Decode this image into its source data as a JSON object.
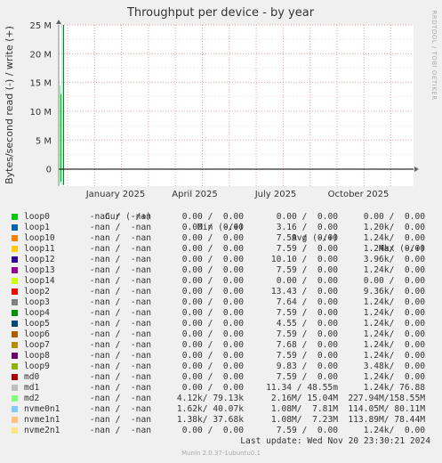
{
  "chart_data": {
    "type": "line",
    "title": "Throughput per device - by year",
    "ylabel": "Bytes/second read (-) / write (+)",
    "side_label": "RRDTOOL / TOBI OETIKER",
    "y_ticks": [
      "25 M",
      "20 M",
      "15 M",
      "10 M",
      "5 M",
      "0"
    ],
    "y_tick_values": [
      25000000,
      20000000,
      15000000,
      10000000,
      5000000,
      0
    ],
    "ylim": [
      -3000000,
      25000000
    ],
    "x_ticks": [
      "January 2025",
      "April 2025",
      "July 2025",
      "October 2025"
    ],
    "grid": true,
    "columns": [
      "Cur (-/+)",
      "Min (-/+)",
      "Avg (-/+)",
      "Max (-/+)"
    ],
    "series": [
      {
        "name": "loop0",
        "color": "#00cc00",
        "cur": "-nan /  -nan",
        "min": "0.00 /  0.00",
        "avg": "0.00 /  0.00",
        "max": "0.00 /  0.00"
      },
      {
        "name": "loop1",
        "color": "#0066b3",
        "cur": "-nan /  -nan",
        "min": "0.00 /  0.00",
        "avg": "3.16 /  0.00",
        "max": "1.20k/  0.00"
      },
      {
        "name": "loop10",
        "color": "#ff8000",
        "cur": "-nan /  -nan",
        "min": "0.00 /  0.00",
        "avg": "7.59 /  0.00",
        "max": "1.24k/  0.00"
      },
      {
        "name": "loop11",
        "color": "#ffcc00",
        "cur": "-nan /  -nan",
        "min": "0.00 /  0.00",
        "avg": "7.59 /  0.00",
        "max": "1.24k/  0.00"
      },
      {
        "name": "loop12",
        "color": "#330099",
        "cur": "-nan /  -nan",
        "min": "0.00 /  0.00",
        "avg": "10.10 /  0.00",
        "max": "3.96k/  0.00"
      },
      {
        "name": "loop13",
        "color": "#990099",
        "cur": "-nan /  -nan",
        "min": "0.00 /  0.00",
        "avg": "7.59 /  0.00",
        "max": "1.24k/  0.00"
      },
      {
        "name": "loop14",
        "color": "#ccff00",
        "cur": "-nan /  -nan",
        "min": "0.00 /  0.00",
        "avg": "0.00 /  0.00",
        "max": "0.00 /  0.00"
      },
      {
        "name": "loop2",
        "color": "#ff0000",
        "cur": "-nan /  -nan",
        "min": "0.00 /  0.00",
        "avg": "13.43 /  0.00",
        "max": "9.36k/  0.00"
      },
      {
        "name": "loop3",
        "color": "#808080",
        "cur": "-nan /  -nan",
        "min": "0.00 /  0.00",
        "avg": "7.64 /  0.00",
        "max": "1.24k/  0.00"
      },
      {
        "name": "loop4",
        "color": "#008f00",
        "cur": "-nan /  -nan",
        "min": "0.00 /  0.00",
        "avg": "7.59 /  0.00",
        "max": "1.24k/  0.00"
      },
      {
        "name": "loop5",
        "color": "#00487d",
        "cur": "-nan /  -nan",
        "min": "0.00 /  0.00",
        "avg": "4.55 /  0.00",
        "max": "1.24k/  0.00"
      },
      {
        "name": "loop6",
        "color": "#b35a00",
        "cur": "-nan /  -nan",
        "min": "0.00 /  0.00",
        "avg": "7.59 /  0.00",
        "max": "1.24k/  0.00"
      },
      {
        "name": "loop7",
        "color": "#b38f00",
        "cur": "-nan /  -nan",
        "min": "0.00 /  0.00",
        "avg": "7.68 /  0.00",
        "max": "1.24k/  0.00"
      },
      {
        "name": "loop8",
        "color": "#6b006b",
        "cur": "-nan /  -nan",
        "min": "0.00 /  0.00",
        "avg": "7.59 /  0.00",
        "max": "1.24k/  0.00"
      },
      {
        "name": "loop9",
        "color": "#8fb300",
        "cur": "-nan /  -nan",
        "min": "0.00 /  0.00",
        "avg": "9.83 /  0.00",
        "max": "3.48k/  0.00"
      },
      {
        "name": "md0",
        "color": "#b30000",
        "cur": "-nan /  -nan",
        "min": "0.00 /  0.00",
        "avg": "7.59 /  0.00",
        "max": "1.24k/  0.00"
      },
      {
        "name": "md1",
        "color": "#bebebe",
        "cur": "-nan /  -nan",
        "min": "0.00 /  0.00",
        "avg": "11.34 / 48.55m",
        "max": "1.24k/ 76.88"
      },
      {
        "name": "md2",
        "color": "#80ff80",
        "cur": "-nan /  -nan",
        "min": "4.12k/ 79.13k",
        "avg": "2.16M/ 15.04M",
        "max": "227.94M/158.55M"
      },
      {
        "name": "nvme0n1",
        "color": "#80c9ff",
        "cur": "-nan /  -nan",
        "min": "1.62k/ 40.07k",
        "avg": "1.08M/  7.81M",
        "max": "114.05M/ 80.11M"
      },
      {
        "name": "nvme1n1",
        "color": "#ffc080",
        "cur": "-nan /  -nan",
        "min": "1.38k/ 37.68k",
        "avg": "1.08M/  7.23M",
        "max": "113.89M/ 78.44M"
      },
      {
        "name": "nvme2n1",
        "color": "#ffe680",
        "cur": "-nan /  -nan",
        "min": "0.00 /  0.00",
        "avg": "7.59 /  0.00",
        "max": "1.24k/  0.00"
      }
    ]
  },
  "footer": {
    "last_update": "Last update: Wed Nov 20 23:30:21 2024",
    "munin_version": "Munin 2.0.37-1ubuntu0.1"
  }
}
